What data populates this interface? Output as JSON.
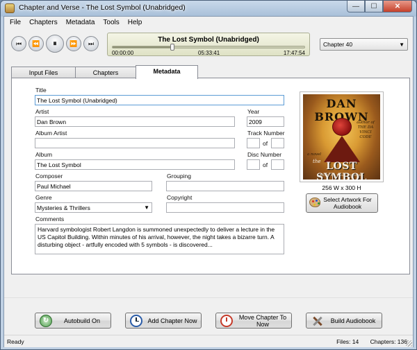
{
  "window": {
    "title": "Chapter and Verse - The Lost Symbol (Unabridged)",
    "buttons": {
      "minimize": "—",
      "maximize": "☐",
      "close": "✕"
    }
  },
  "menu": [
    {
      "label": "File"
    },
    {
      "label": "Chapters"
    },
    {
      "label": "Metadata"
    },
    {
      "label": "Tools"
    },
    {
      "label": "Help"
    }
  ],
  "player": {
    "buttons": {
      "first": "⏮",
      "rewind": "⏪",
      "pause": "⏸",
      "forward": "⏩",
      "last": "⏭"
    },
    "title": "The Lost Symbol (Unabridged)",
    "time_start": "00:00:00",
    "time_current": "05:33:41",
    "time_total": "17:47:54",
    "progress": 0.312
  },
  "chapter_dropdown": {
    "selected": "Chapter 40",
    "arrow": "▼"
  },
  "tabs": [
    {
      "label": "Input Files"
    },
    {
      "label": "Chapters"
    },
    {
      "label": "Metadata"
    }
  ],
  "metadata": {
    "title_label": "Title",
    "title_value": "The Lost Symbol (Unabridged)",
    "artist_label": "Artist",
    "artist_value": "Dan Brown",
    "year_label": "Year",
    "year_value": "2009",
    "album_artist_label": "Album Artist",
    "album_artist_value": "",
    "track_number_label": "Track Number",
    "track_value": "",
    "track_of_label": "of",
    "track_total": "",
    "album_label": "Album",
    "album_value": "The Lost Symbol",
    "disc_number_label": "Disc Number",
    "disc_value": "",
    "disc_of_label": "of",
    "disc_total": "",
    "composer_label": "Composer",
    "composer_value": "Paul Michael",
    "grouping_label": "Grouping",
    "grouping_value": "",
    "genre_label": "Genre",
    "genre_value": "Mysteries & Thrillers",
    "genre_arrow": "▼",
    "copyright_label": "Copyright",
    "copyright_value": "",
    "comments_label": "Comments",
    "comments_value": "Harvard symbologist Robert Langdon is summoned unexpectedly to deliver a lecture in the US Capitol Building. Within minutes of his arrival, however, the night takes a bizarre turn. A disturbing object - artfully encoded with 5 symbols - is discovered..."
  },
  "artwork": {
    "cover_author": "DAN BROWN",
    "cover_title": "LOST SYMBOL",
    "cover_the": "the",
    "cover_note": "author of THE DA VINCI CODE",
    "cover_small": "a novel",
    "cover_bottom": "READ BY PAUL MICHAEL",
    "size_text": "256 W x 300 H",
    "select_button": "Select Artwork For Audiobook"
  },
  "actions": [
    {
      "label": "Autobuild On",
      "icon": "refresh-icon"
    },
    {
      "label": "Add Chapter Now",
      "icon": "clock-icon"
    },
    {
      "label": "Move Chapter To Now",
      "icon": "stopwatch-icon"
    },
    {
      "label": "Build Audiobook",
      "icon": "tools-icon"
    }
  ],
  "status": {
    "left": "Ready",
    "files": "Files: 14",
    "chapters": "Chapters: 136"
  }
}
